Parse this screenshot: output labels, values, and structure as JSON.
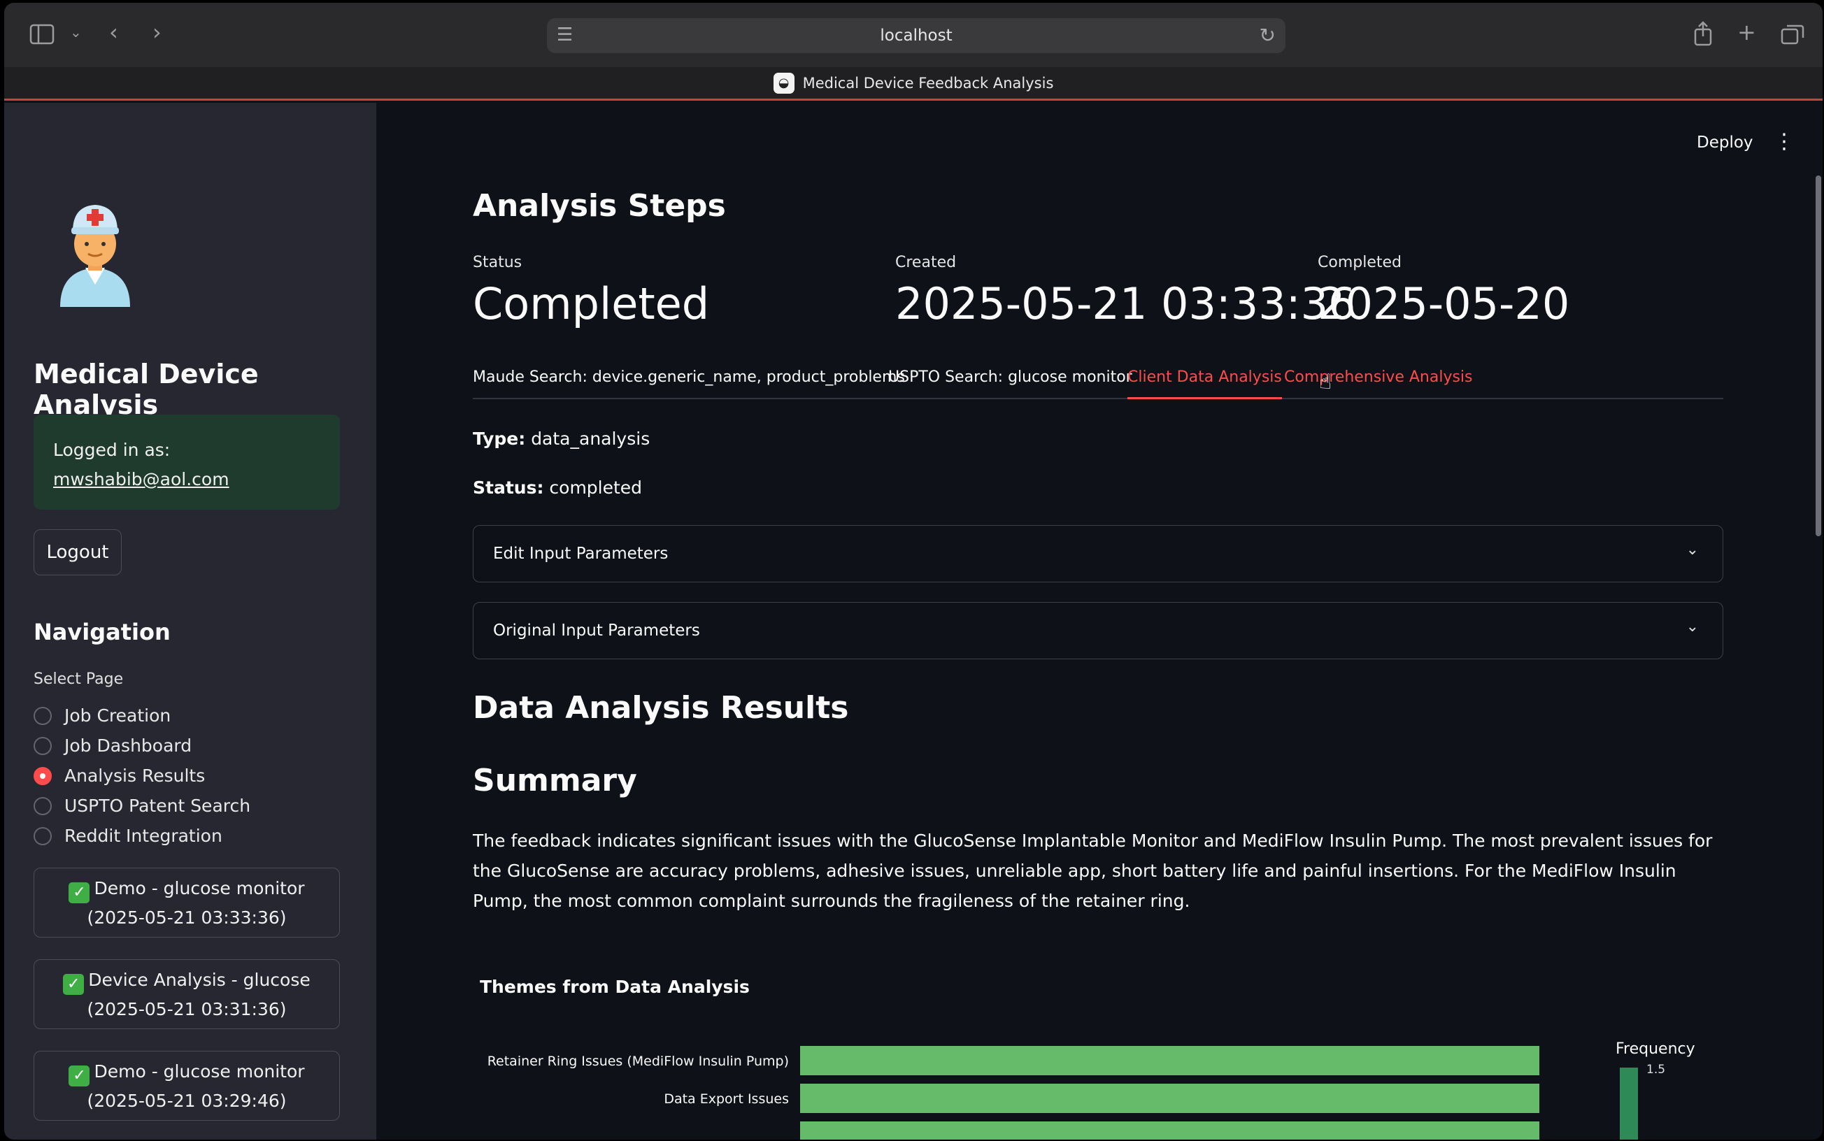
{
  "browser": {
    "url": "localhost",
    "tab_title": "Medical Device Feedback Analysis"
  },
  "header": {
    "deploy_label": "Deploy",
    "menu_icon": "kebab-menu-icon"
  },
  "sidebar": {
    "title": "Medical Device Analysis",
    "login_label": "Logged in as:",
    "login_email": "mwshabib@aol.com",
    "logout_label": "Logout",
    "nav_title": "Navigation",
    "select_label": "Select Page",
    "pages": [
      {
        "label": "Job Creation",
        "selected": false
      },
      {
        "label": "Job Dashboard",
        "selected": false
      },
      {
        "label": "Analysis Results",
        "selected": true
      },
      {
        "label": "USPTO Patent Search",
        "selected": false
      },
      {
        "label": "Reddit Integration",
        "selected": false
      }
    ],
    "jobs": [
      {
        "name": "Demo - glucose monitor",
        "time": "(2025-05-21 03:33:36)"
      },
      {
        "name": "Device Analysis - glucose",
        "time": "(2025-05-21 03:31:36)"
      },
      {
        "name": "Demo - glucose monitor",
        "time": "(2025-05-21 03:29:46)"
      }
    ]
  },
  "main": {
    "heading": "Analysis Steps",
    "metrics": [
      {
        "label": "Status",
        "value": "Completed"
      },
      {
        "label": "Created",
        "value": "2025-05-21 03:33:36"
      },
      {
        "label": "Completed",
        "value": "2025-05-20"
      }
    ],
    "tabs": [
      {
        "label": "Maude Search: device.generic_name, product_problems",
        "state": "normal"
      },
      {
        "label": "USPTO Search: glucose monitor",
        "state": "normal"
      },
      {
        "label": "Client Data Analysis",
        "state": "active"
      },
      {
        "label": "Comprehensive Analysis",
        "state": "hover"
      }
    ],
    "type_label": "Type:",
    "type_value": "data_analysis",
    "status_label": "Status:",
    "status_value": "completed",
    "expanders": [
      {
        "label": "Edit Input Parameters"
      },
      {
        "label": "Original Input Parameters"
      }
    ],
    "results_heading": "Data Analysis Results",
    "summary_heading": "Summary",
    "summary_text": "The feedback indicates significant issues with the GlucoSense Implantable Monitor and MediFlow Insulin Pump. The most prevalent issues for the GlucoSense are accuracy problems, adhesive issues, unreliable app, short battery life and painful insertions. For the MediFlow Insulin Pump, the most common complaint surrounds the fragileness of the retainer ring."
  },
  "chart_data": {
    "type": "bar",
    "orientation": "horizontal",
    "title": "Themes from Data Analysis",
    "categories": [
      "Retainer Ring Issues (MediFlow Insulin Pump)",
      "Data Export Issues"
    ],
    "values": [
      1,
      1
    ],
    "xlim": [
      0,
      1
    ],
    "legend_title": "Frequency",
    "legend_tick": "1.5",
    "bar_color": "#66bb6a",
    "legend_color": "#2e8b57"
  }
}
